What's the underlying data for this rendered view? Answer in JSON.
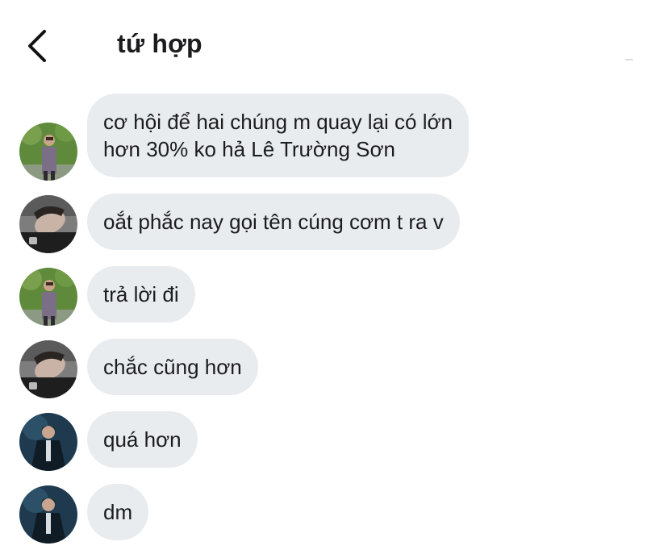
{
  "header": {
    "title": "tứ hợp",
    "back_icon": "chevron-left-icon"
  },
  "messages": [
    {
      "text": "cơ hội để hai chúng m quay lại có lớn\nhơn 30% ko hả Lê Trường Sơn",
      "avatar": "avatar-green-park"
    },
    {
      "text": "oắt phắc nay gọi tên cúng cơm t ra v",
      "avatar": "avatar-reclining"
    },
    {
      "text": "trả lời đi",
      "avatar": "avatar-green-park"
    },
    {
      "text": "chắc cũng hơn",
      "avatar": "avatar-reclining"
    },
    {
      "text": "quá hơn",
      "avatar": "avatar-dark-suit"
    },
    {
      "text": "dm",
      "avatar": "avatar-dark-suit"
    }
  ],
  "colors": {
    "bubble": "#e9ecef",
    "text": "#1c1c1e",
    "background": "#ffffff"
  }
}
